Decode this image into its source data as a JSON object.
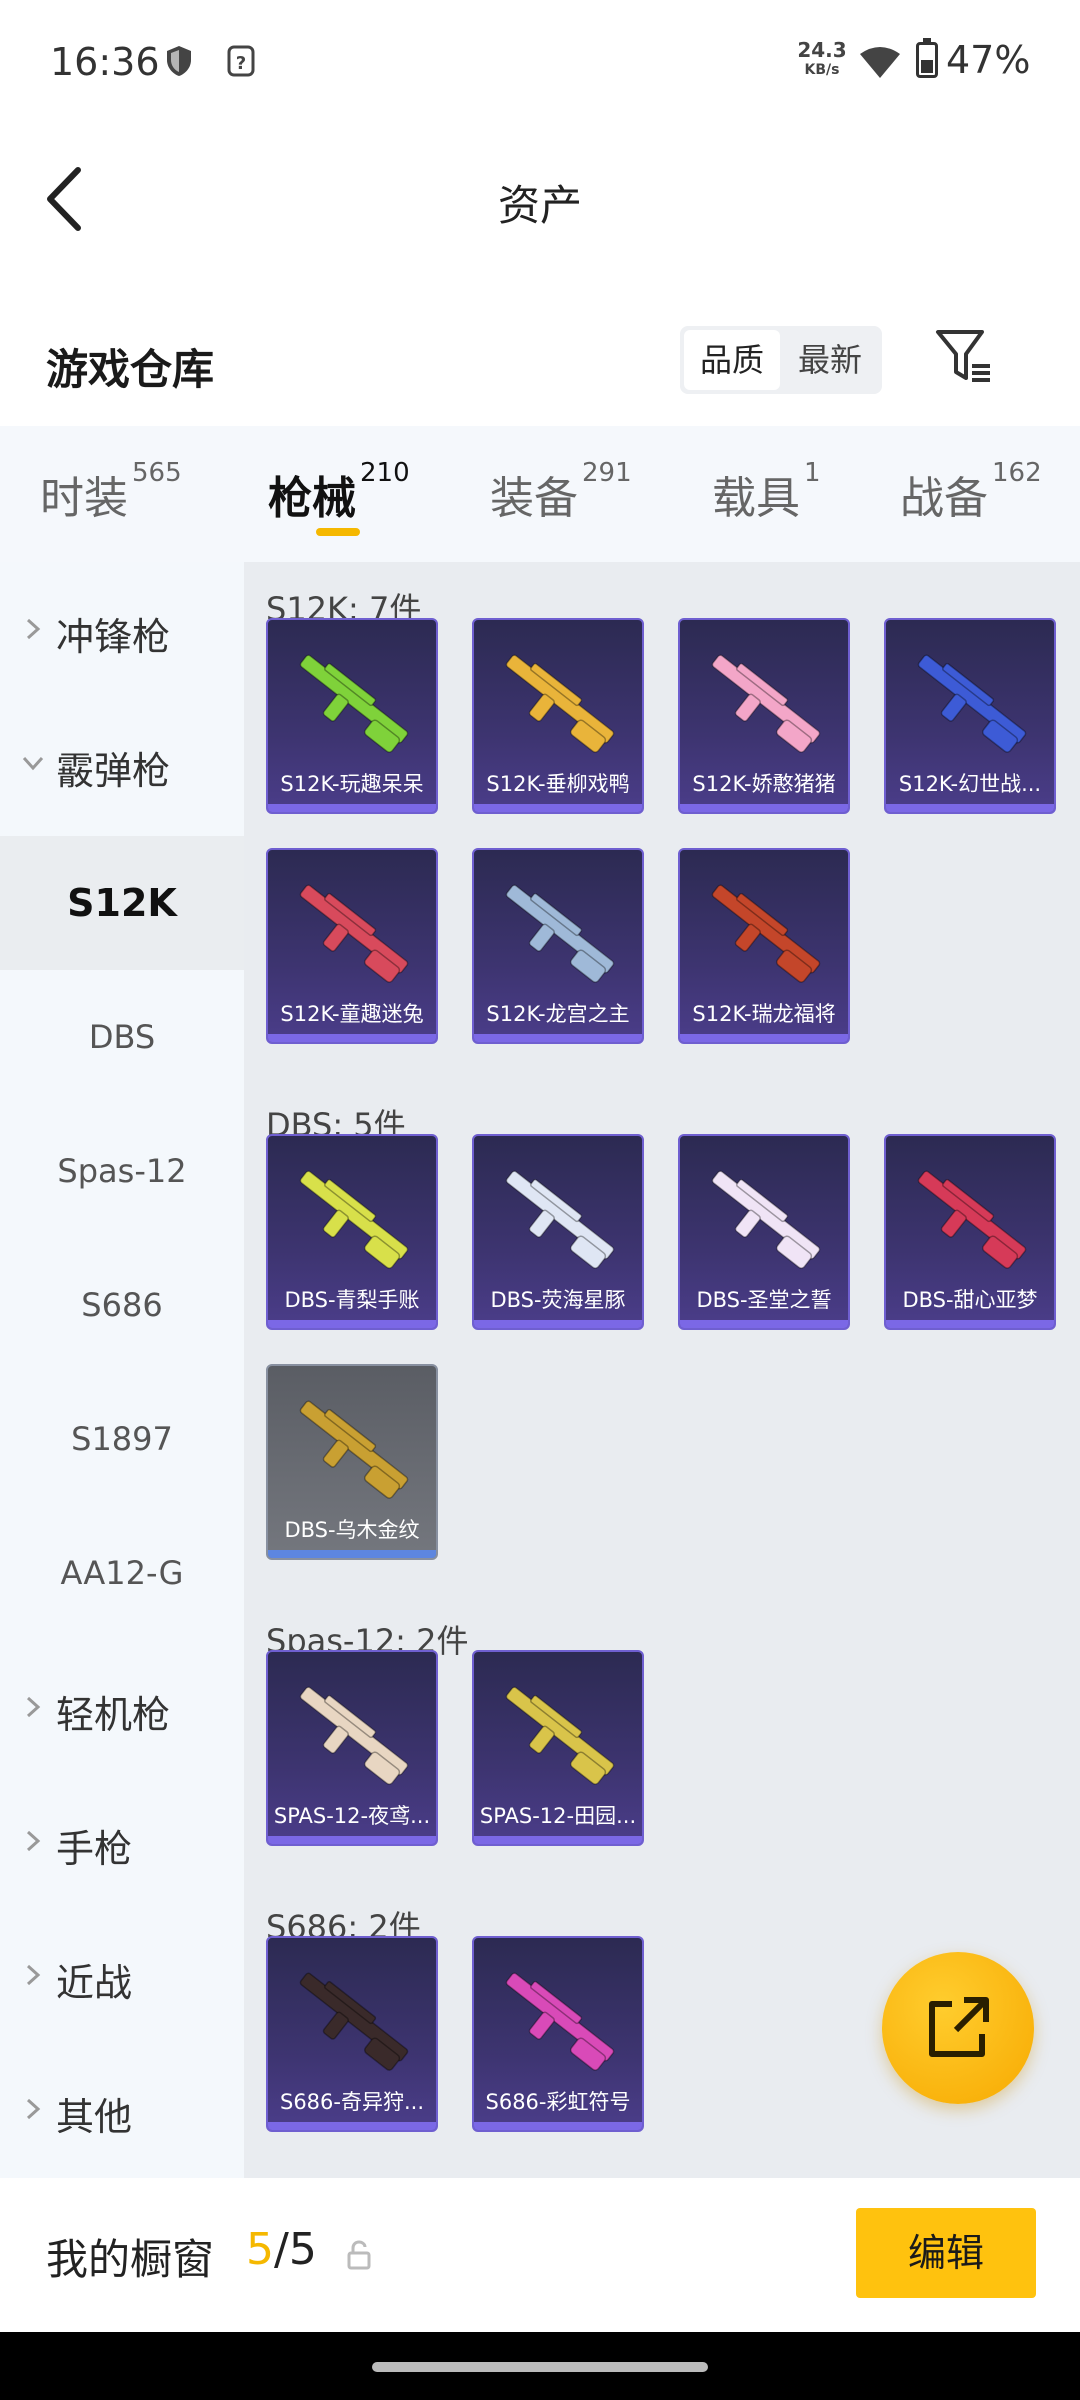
{
  "status_bar": {
    "time": "16:36",
    "net_speed_value": "24.3",
    "net_speed_unit": "KB/s",
    "battery_percent": "47%",
    "icons": [
      "shield-icon",
      "question-box-icon",
      "wifi-icon",
      "battery-icon"
    ]
  },
  "header": {
    "title": "资产",
    "back_icon": "chevron-left-icon"
  },
  "warehouse": {
    "title": "游戏仓库",
    "sort_options": [
      "品质",
      "最新"
    ],
    "sort_selected": "品质",
    "filter_icon": "filter-icon"
  },
  "tabs": [
    {
      "label": "时装",
      "count": "565",
      "active": false
    },
    {
      "label": "枪械",
      "count": "210",
      "active": true
    },
    {
      "label": "装备",
      "count": "291",
      "active": false
    },
    {
      "label": "载具",
      "count": "1",
      "active": false
    },
    {
      "label": "战备",
      "count": "162",
      "active": false
    }
  ],
  "sidebar": {
    "group_submachine": "冲锋枪",
    "group_shotgun": "霰弹枪",
    "items": [
      "S12K",
      "DBS",
      "Spas-12",
      "S686",
      "S1897",
      "AA12-G"
    ],
    "selected": "S12K",
    "group_lmg": "轻机枪",
    "group_pistol": "手枪",
    "group_melee": "近战",
    "group_other": "其他"
  },
  "sections": [
    {
      "title": "S12K: 7件",
      "cards": [
        {
          "name": "S12K-玩趣呆呆",
          "color": "#7fd23a"
        },
        {
          "name": "S12K-垂柳戏鸭",
          "color": "#e9b43a"
        },
        {
          "name": "S12K-娇憨猪猪",
          "color": "#f3a6c8"
        },
        {
          "name": "S12K-幻世战...",
          "color": "#3d5bd6"
        },
        {
          "name": "S12K-童趣迷兔",
          "color": "#d84a5c"
        },
        {
          "name": "S12K-龙宫之主",
          "color": "#9fb9d8"
        },
        {
          "name": "S12K-瑞龙福将",
          "color": "#c4462a"
        }
      ]
    },
    {
      "title": "DBS: 5件",
      "cards": [
        {
          "name": "DBS-青梨手账",
          "color": "#d8e04a"
        },
        {
          "name": "DBS-荧海星豚",
          "color": "#dfe6f4"
        },
        {
          "name": "DBS-圣堂之誓",
          "color": "#f0e4f6"
        },
        {
          "name": "DBS-甜心亚梦",
          "color": "#d63a58"
        },
        {
          "name": "DBS-乌木金纹",
          "color": "#c9a032",
          "gray": true
        }
      ]
    },
    {
      "title": "Spas-12: 2件",
      "cards": [
        {
          "name": "SPAS-12-夜鸢...",
          "color": "#e8d6c2"
        },
        {
          "name": "SPAS-12-田园...",
          "color": "#d9c44a"
        }
      ]
    },
    {
      "title": "S686: 2件",
      "cards": [
        {
          "name": "S686-奇异狩...",
          "color": "#3a2a2a"
        },
        {
          "name": "S686-彩虹符号",
          "color": "#d94ab8"
        }
      ]
    }
  ],
  "fab": {
    "icon": "share-out-icon"
  },
  "bottom_bar": {
    "label": "我的橱窗",
    "count_current": "5",
    "count_sep_total": "/5",
    "lock_icon": "lock-icon",
    "edit_label": "编辑"
  }
}
